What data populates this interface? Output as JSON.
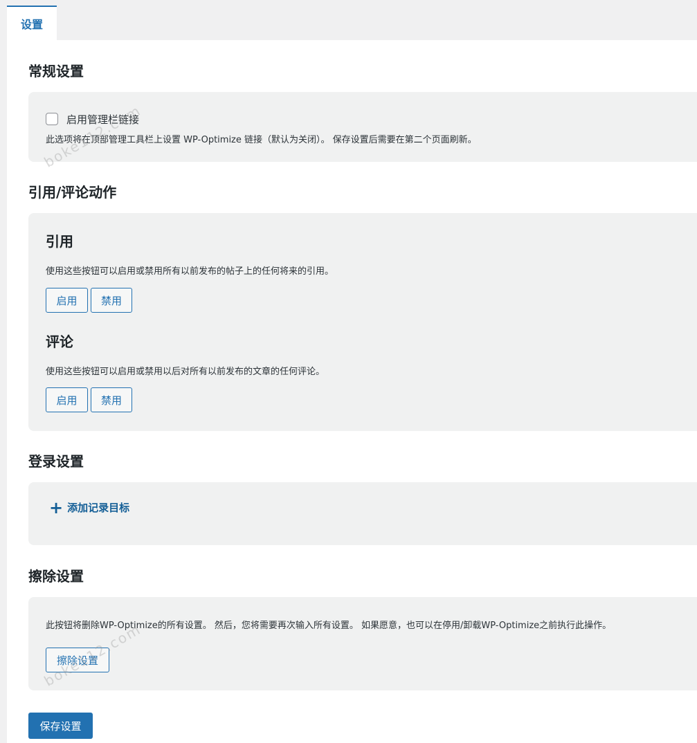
{
  "tabs": [
    {
      "label": "设置",
      "active": true
    }
  ],
  "general": {
    "title": "常规设置",
    "checkbox_label": "启用管理栏链接",
    "checkbox_checked": false,
    "description": "此选项将在顶部管理工具栏上设置 WP-Optimize 链接（默认为关闭）。 保存设置后需要在第二个页面刷新。"
  },
  "trackback_comment": {
    "title": "引用/评论动作",
    "trackbacks": {
      "title": "引用",
      "description": "使用这些按钮可以启用或禁用所有以前发布的帖子上的任何将来的引用。",
      "enable_label": "启用",
      "disable_label": "禁用"
    },
    "comments": {
      "title": "评论",
      "description": "使用这些按钮可以启用或禁用以后对所有以前发布的文章的任何评论。",
      "enable_label": "启用",
      "disable_label": "禁用"
    }
  },
  "logging": {
    "title": "登录设置",
    "add_label": "添加记录目标"
  },
  "wipe": {
    "title": "擦除设置",
    "description": "此按钮将删除WP-Optimize的所有设置。 然后，您将需要再次输入所有设置。 如果愿意，也可以在停用/卸载WP-Optimize之前执行此操作。",
    "button_label": "擦除设置"
  },
  "save_label": "保存设置",
  "watermark": "boke112.com",
  "accent_color": "#2271b1"
}
